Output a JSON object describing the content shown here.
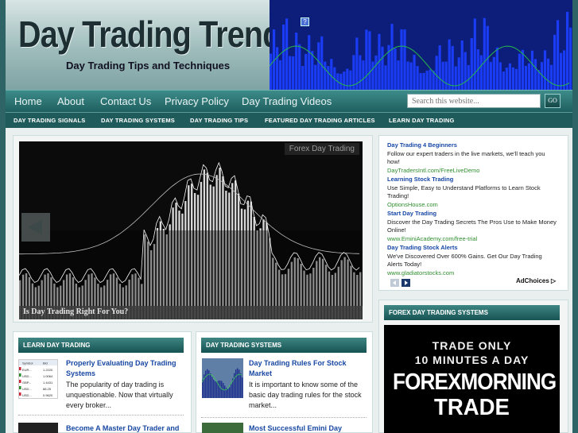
{
  "header": {
    "title": "Day Trading Trend",
    "tagline": "Day Trading Tips and Techniques"
  },
  "mainnav": [
    "Home",
    "About",
    "Contact Us",
    "Privacy Policy",
    "Day Trading Videos"
  ],
  "search": {
    "placeholder": "Search this website...",
    "button_label": "GO"
  },
  "subnav": [
    "DAY TRADING SIGNALS",
    "DAY TRADING SYSTEMS",
    "DAY TRADING TIPS",
    "FEATURED DAY TRADING ARTICLES",
    "LEARN DAY TRADING"
  ],
  "slider": {
    "tag": "Forex Day Trading",
    "caption": "Is Day Trading Right For You?"
  },
  "ads": [
    {
      "title": "Day Trading 4 Beginners",
      "text": "Follow our expert traders in the live markets, we'll teach you how!",
      "url": "DayTradersIntl.com/FreeLiveDemo"
    },
    {
      "title": "Learning Stock Trading",
      "text": "Use Simple, Easy to Understand Platforms to Learn Stock Trading!",
      "url": "OptionsHouse.com"
    },
    {
      "title": "Start Day Trading",
      "text": "Discover the Day Trading Secrets The Pros Use to Make Money Online!",
      "url": "www.EminiAcademy.com/free-trial"
    },
    {
      "title": "Day Trading Stock Alerts",
      "text": "We've Discovered Over 600% Gains. Get Our Day Trading Alerts Today!",
      "url": "www.gladiatorstocks.com"
    }
  ],
  "adchoices": "AdChoices",
  "forex_widget": {
    "heading": "FOREX DAY TRADING SYSTEMS",
    "banner": [
      "TRADE ONLY",
      "10 MINUTES A DAY",
      "FOREXMORNING",
      "TRADE"
    ]
  },
  "learn": {
    "heading": "LEARN DAY TRADING",
    "posts": [
      {
        "title": "Properly Evaluating Day Trading Systems",
        "excerpt": "The popularity of day trading is unquestionable. Now that virtually every broker..."
      },
      {
        "title": "Become A Master Day Trader and",
        "excerpt": ""
      }
    ],
    "thumb": {
      "headers": [
        "Symbol",
        "Bid"
      ],
      "rows": [
        [
          "EUR...",
          "1.2220"
        ],
        [
          "USD...",
          "1.0064"
        ],
        [
          "GBP...",
          "1.4431"
        ],
        [
          "USD...",
          "88.25"
        ],
        [
          "USD...",
          "0.9620"
        ]
      ]
    }
  },
  "systems": {
    "heading": "DAY TRADING SYSTEMS",
    "posts": [
      {
        "title": "Day Trading Rules For Stock Market",
        "excerpt": "It is important to know some of the basic day trading rules for the stock market..."
      },
      {
        "title": "Most Successful Emini Day",
        "excerpt": ""
      }
    ]
  },
  "colors": {
    "brand_teal": "#1f5b5a",
    "link_blue": "#1848a3",
    "ad_url_green": "#2f8e2f"
  }
}
